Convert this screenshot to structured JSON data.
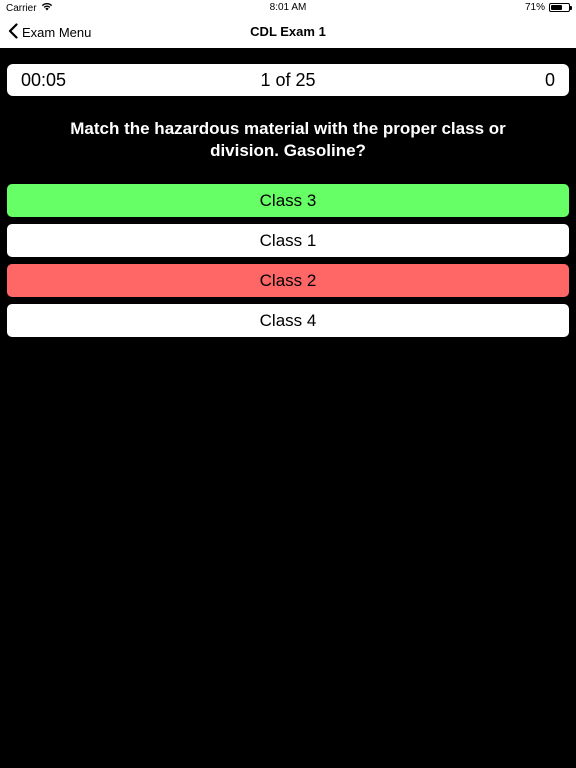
{
  "status_bar": {
    "carrier": "Carrier",
    "wifi_icon": "wifi-icon",
    "time": "8:01 AM",
    "battery_percent": "71%",
    "battery_level": 0.71
  },
  "nav": {
    "back_label": "Exam Menu",
    "back_icon": "chevron-left-icon",
    "title": "CDL Exam 1"
  },
  "info": {
    "timer": "00:05",
    "progress": "1 of 25",
    "score": "0"
  },
  "question": {
    "text": "Match the hazardous material with the proper class or division. Gasoline?"
  },
  "answers": [
    {
      "label": "Class 3",
      "state": "correct",
      "color": "#66ff66"
    },
    {
      "label": "Class 1",
      "state": "neutral",
      "color": "#ffffff"
    },
    {
      "label": "Class 2",
      "state": "incorrect",
      "color": "#ff6666"
    },
    {
      "label": "Class 4",
      "state": "neutral",
      "color": "#ffffff"
    }
  ]
}
